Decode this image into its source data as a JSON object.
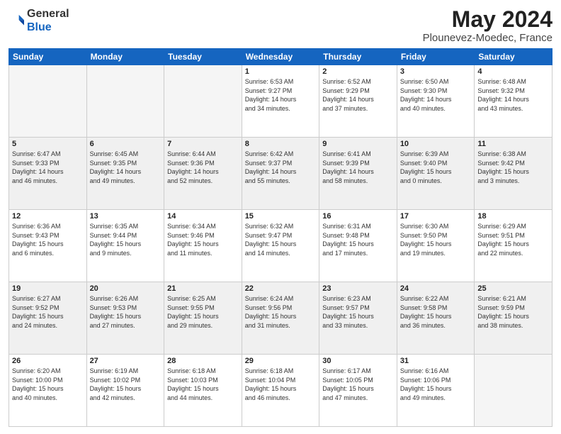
{
  "header": {
    "logo_line1": "General",
    "logo_line2": "Blue",
    "title": "May 2024",
    "location": "Plounevez-Moedec, France"
  },
  "weekdays": [
    "Sunday",
    "Monday",
    "Tuesday",
    "Wednesday",
    "Thursday",
    "Friday",
    "Saturday"
  ],
  "weeks": [
    [
      {
        "day": "",
        "detail": ""
      },
      {
        "day": "",
        "detail": ""
      },
      {
        "day": "",
        "detail": ""
      },
      {
        "day": "1",
        "detail": "Sunrise: 6:53 AM\nSunset: 9:27 PM\nDaylight: 14 hours\nand 34 minutes."
      },
      {
        "day": "2",
        "detail": "Sunrise: 6:52 AM\nSunset: 9:29 PM\nDaylight: 14 hours\nand 37 minutes."
      },
      {
        "day": "3",
        "detail": "Sunrise: 6:50 AM\nSunset: 9:30 PM\nDaylight: 14 hours\nand 40 minutes."
      },
      {
        "day": "4",
        "detail": "Sunrise: 6:48 AM\nSunset: 9:32 PM\nDaylight: 14 hours\nand 43 minutes."
      }
    ],
    [
      {
        "day": "5",
        "detail": "Sunrise: 6:47 AM\nSunset: 9:33 PM\nDaylight: 14 hours\nand 46 minutes."
      },
      {
        "day": "6",
        "detail": "Sunrise: 6:45 AM\nSunset: 9:35 PM\nDaylight: 14 hours\nand 49 minutes."
      },
      {
        "day": "7",
        "detail": "Sunrise: 6:44 AM\nSunset: 9:36 PM\nDaylight: 14 hours\nand 52 minutes."
      },
      {
        "day": "8",
        "detail": "Sunrise: 6:42 AM\nSunset: 9:37 PM\nDaylight: 14 hours\nand 55 minutes."
      },
      {
        "day": "9",
        "detail": "Sunrise: 6:41 AM\nSunset: 9:39 PM\nDaylight: 14 hours\nand 58 minutes."
      },
      {
        "day": "10",
        "detail": "Sunrise: 6:39 AM\nSunset: 9:40 PM\nDaylight: 15 hours\nand 0 minutes."
      },
      {
        "day": "11",
        "detail": "Sunrise: 6:38 AM\nSunset: 9:42 PM\nDaylight: 15 hours\nand 3 minutes."
      }
    ],
    [
      {
        "day": "12",
        "detail": "Sunrise: 6:36 AM\nSunset: 9:43 PM\nDaylight: 15 hours\nand 6 minutes."
      },
      {
        "day": "13",
        "detail": "Sunrise: 6:35 AM\nSunset: 9:44 PM\nDaylight: 15 hours\nand 9 minutes."
      },
      {
        "day": "14",
        "detail": "Sunrise: 6:34 AM\nSunset: 9:46 PM\nDaylight: 15 hours\nand 11 minutes."
      },
      {
        "day": "15",
        "detail": "Sunrise: 6:32 AM\nSunset: 9:47 PM\nDaylight: 15 hours\nand 14 minutes."
      },
      {
        "day": "16",
        "detail": "Sunrise: 6:31 AM\nSunset: 9:48 PM\nDaylight: 15 hours\nand 17 minutes."
      },
      {
        "day": "17",
        "detail": "Sunrise: 6:30 AM\nSunset: 9:50 PM\nDaylight: 15 hours\nand 19 minutes."
      },
      {
        "day": "18",
        "detail": "Sunrise: 6:29 AM\nSunset: 9:51 PM\nDaylight: 15 hours\nand 22 minutes."
      }
    ],
    [
      {
        "day": "19",
        "detail": "Sunrise: 6:27 AM\nSunset: 9:52 PM\nDaylight: 15 hours\nand 24 minutes."
      },
      {
        "day": "20",
        "detail": "Sunrise: 6:26 AM\nSunset: 9:53 PM\nDaylight: 15 hours\nand 27 minutes."
      },
      {
        "day": "21",
        "detail": "Sunrise: 6:25 AM\nSunset: 9:55 PM\nDaylight: 15 hours\nand 29 minutes."
      },
      {
        "day": "22",
        "detail": "Sunrise: 6:24 AM\nSunset: 9:56 PM\nDaylight: 15 hours\nand 31 minutes."
      },
      {
        "day": "23",
        "detail": "Sunrise: 6:23 AM\nSunset: 9:57 PM\nDaylight: 15 hours\nand 33 minutes."
      },
      {
        "day": "24",
        "detail": "Sunrise: 6:22 AM\nSunset: 9:58 PM\nDaylight: 15 hours\nand 36 minutes."
      },
      {
        "day": "25",
        "detail": "Sunrise: 6:21 AM\nSunset: 9:59 PM\nDaylight: 15 hours\nand 38 minutes."
      }
    ],
    [
      {
        "day": "26",
        "detail": "Sunrise: 6:20 AM\nSunset: 10:00 PM\nDaylight: 15 hours\nand 40 minutes."
      },
      {
        "day": "27",
        "detail": "Sunrise: 6:19 AM\nSunset: 10:02 PM\nDaylight: 15 hours\nand 42 minutes."
      },
      {
        "day": "28",
        "detail": "Sunrise: 6:18 AM\nSunset: 10:03 PM\nDaylight: 15 hours\nand 44 minutes."
      },
      {
        "day": "29",
        "detail": "Sunrise: 6:18 AM\nSunset: 10:04 PM\nDaylight: 15 hours\nand 46 minutes."
      },
      {
        "day": "30",
        "detail": "Sunrise: 6:17 AM\nSunset: 10:05 PM\nDaylight: 15 hours\nand 47 minutes."
      },
      {
        "day": "31",
        "detail": "Sunrise: 6:16 AM\nSunset: 10:06 PM\nDaylight: 15 hours\nand 49 minutes."
      },
      {
        "day": "",
        "detail": ""
      }
    ]
  ]
}
